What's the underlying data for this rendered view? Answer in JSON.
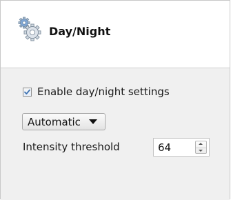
{
  "header": {
    "title": "Day/Night",
    "icon": "gears-icon"
  },
  "settings": {
    "enable_checkbox": {
      "label": "Enable day/night settings",
      "checked": true
    },
    "mode_select": {
      "selected": "Automatic"
    },
    "intensity_threshold": {
      "label": "Intensity threshold",
      "value": "64"
    }
  },
  "colors": {
    "panel_background": "#f0f0f0",
    "header_background": "#ffffff",
    "checkmark": "#3a6fb0",
    "gear_fill": "#c9d3dd",
    "gear_accent": "#6d9bd0"
  }
}
